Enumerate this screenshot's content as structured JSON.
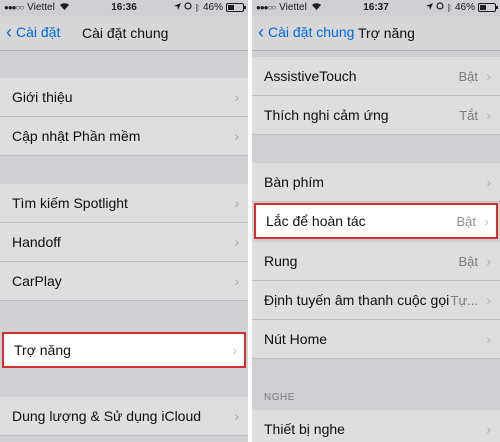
{
  "left": {
    "status": {
      "carrier": "Viettel",
      "time": "16:36",
      "battery": "46%",
      "battery_level": 0.46
    },
    "nav": {
      "back_label": "Cài đặt",
      "title": "Cài đặt chung"
    },
    "rows": [
      {
        "label": "Giới thiệu"
      },
      {
        "label": "Cập nhật Phần mềm"
      },
      {
        "label": "Tìm kiếm Spotlight"
      },
      {
        "label": "Handoff"
      },
      {
        "label": "CarPlay"
      },
      {
        "label": "Dung lượng & Sử dụng iCloud"
      }
    ],
    "highlight": {
      "label": "Trợ năng"
    }
  },
  "right": {
    "status": {
      "carrier": "Viettel",
      "time": "16:37",
      "battery": "46%",
      "battery_level": 0.46
    },
    "nav": {
      "back_label": "Cài đặt chung",
      "title": "Trợ năng"
    },
    "rows": [
      {
        "label": "AssistiveTouch",
        "value": "Bật"
      },
      {
        "label": "Thích nghi cảm ứng",
        "value": "Tắt"
      },
      {
        "label": "Bàn phím",
        "value": ""
      },
      {
        "label": "Rung",
        "value": "Bật"
      },
      {
        "label": "Định tuyến âm thanh cuộc gọi",
        "value": "Tự..."
      },
      {
        "label": "Nút Home",
        "value": ""
      },
      {
        "label": "Thiết bị nghe",
        "value": ""
      }
    ],
    "section_header": "NGHE",
    "highlight": {
      "label": "Lắc để hoàn tác",
      "value": "Bật"
    }
  },
  "icons": {
    "back": "chevron-left-icon",
    "disclosure": "chevron-right-icon",
    "wifi": "wifi-icon",
    "alarm": "alarm-icon",
    "bluetooth": "bluetooth-icon",
    "battery": "battery-icon",
    "location": "location-icon",
    "signal": "signal-dots-icon"
  },
  "colors": {
    "accent": "#007aff",
    "highlight_border": "#d32f2f",
    "background": "#efeff4"
  }
}
